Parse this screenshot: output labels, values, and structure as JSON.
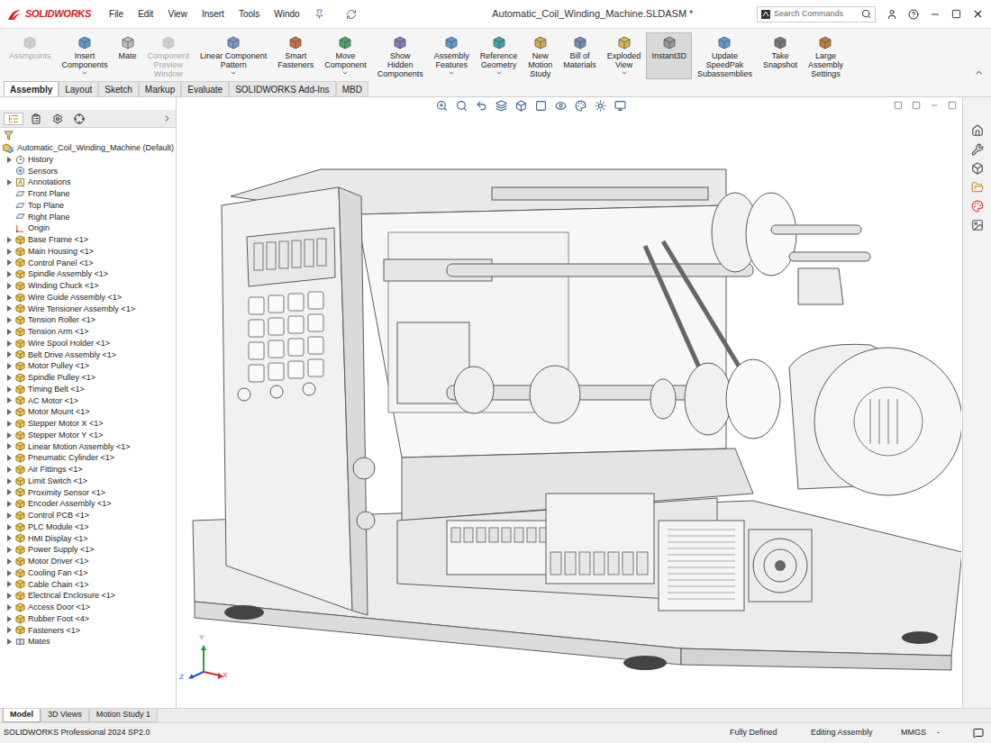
{
  "window": {
    "title": "Automatic_Coil_Winding_Machine.SLDASM *"
  },
  "app": {
    "logo": "SOLIDWORKS"
  },
  "menu": [
    "File",
    "Edit",
    "View",
    "Insert",
    "Tools",
    "Windo"
  ],
  "search": {
    "placeholder": "Search Commands"
  },
  "ribbon": [
    {
      "lines": [
        "Assmpoints"
      ],
      "disabled": true,
      "dropdown": false,
      "selected": false
    },
    {
      "lines": [
        "Insert",
        "Components"
      ],
      "disabled": false,
      "dropdown": true,
      "selected": false
    },
    {
      "lines": [
        "Mate"
      ],
      "disabled": false,
      "dropdown": false,
      "selected": false
    },
    {
      "lines": [
        "Component",
        "Preview",
        "Window"
      ],
      "disabled": true,
      "dropdown": false,
      "selected": false
    },
    {
      "lines": [
        "Linear Component",
        "Pattern"
      ],
      "disabled": false,
      "dropdown": true,
      "selected": false
    },
    {
      "lines": [
        "Smart",
        "Fasteners"
      ],
      "disabled": false,
      "dropdown": false,
      "selected": false
    },
    {
      "lines": [
        "Move",
        "Component"
      ],
      "disabled": false,
      "dropdown": true,
      "selected": false
    },
    {
      "lines": [
        "Show",
        "Hidden",
        "Components"
      ],
      "disabled": false,
      "dropdown": false,
      "selected": false
    },
    {
      "lines": [
        "Assembly",
        "Features"
      ],
      "disabled": false,
      "dropdown": true,
      "selected": false
    },
    {
      "lines": [
        "Reference",
        "Geometry"
      ],
      "disabled": false,
      "dropdown": true,
      "selected": false
    },
    {
      "lines": [
        "New",
        "Motion",
        "Study"
      ],
      "disabled": false,
      "dropdown": false,
      "selected": false
    },
    {
      "lines": [
        "Bill of",
        "Materials"
      ],
      "disabled": false,
      "dropdown": false,
      "selected": false
    },
    {
      "lines": [
        "Exploded",
        "View"
      ],
      "disabled": false,
      "dropdown": true,
      "selected": false
    },
    {
      "lines": [
        "Instant3D"
      ],
      "disabled": false,
      "dropdown": false,
      "selected": true
    },
    {
      "lines": [
        "Update",
        "SpeedPak",
        "Subassemblies"
      ],
      "disabled": false,
      "dropdown": false,
      "selected": false
    },
    {
      "lines": [
        "Take",
        "Snapshot"
      ],
      "disabled": false,
      "dropdown": false,
      "selected": false
    },
    {
      "lines": [
        "Large",
        "Assembly",
        "Settings"
      ],
      "disabled": false,
      "dropdown": false,
      "selected": false
    }
  ],
  "ribbon_tabs": [
    {
      "label": "Assembly",
      "selected": true
    },
    {
      "label": "Layout",
      "selected": false
    },
    {
      "label": "Sketch",
      "selected": false
    },
    {
      "label": "Markup",
      "selected": false
    },
    {
      "label": "Evaluate",
      "selected": false
    },
    {
      "label": "SOLIDWORKS Add-Ins",
      "selected": false
    },
    {
      "label": "MBD",
      "selected": false
    }
  ],
  "tree": {
    "root": "Automatic_Coil_Winding_Machine (Default)",
    "items": [
      {
        "label": "History",
        "kind": "history",
        "expandable": true
      },
      {
        "label": "Sensors",
        "kind": "sensor",
        "expandable": false
      },
      {
        "label": "Annotations",
        "kind": "annotation",
        "expandable": true
      },
      {
        "label": "Front Plane",
        "kind": "plane",
        "expandable": false
      },
      {
        "label": "Top Plane",
        "kind": "plane",
        "expandable": false
      },
      {
        "label": "Right Plane",
        "kind": "plane",
        "expandable": false
      },
      {
        "label": "Origin",
        "kind": "origin",
        "expandable": false
      },
      {
        "label": "Base Frame <1>",
        "kind": "part",
        "expandable": true
      },
      {
        "label": "Main Housing <1>",
        "kind": "part",
        "expandable": true
      },
      {
        "label": "Control Panel <1>",
        "kind": "part",
        "expandable": true
      },
      {
        "label": "Spindle Assembly <1>",
        "kind": "part",
        "expandable": true
      },
      {
        "label": "Winding Chuck <1>",
        "kind": "part",
        "expandable": true
      },
      {
        "label": "Wire Guide Assembly <1>",
        "kind": "part",
        "expandable": true
      },
      {
        "label": "Wire Tensioner Assembly <1>",
        "kind": "part",
        "expandable": true
      },
      {
        "label": "Tension Roller <1>",
        "kind": "part",
        "expandable": true
      },
      {
        "label": "Tension Arm <1>",
        "kind": "part",
        "expandable": true
      },
      {
        "label": "Wire Spool Holder <1>",
        "kind": "part",
        "expandable": true
      },
      {
        "label": "Belt Drive Assembly <1>",
        "kind": "part",
        "expandable": true
      },
      {
        "label": "Motor Pulley <1>",
        "kind": "part",
        "expandable": true
      },
      {
        "label": "Spindle Pulley <1>",
        "kind": "part",
        "expandable": true
      },
      {
        "label": "Timing Belt <1>",
        "kind": "part",
        "expandable": true
      },
      {
        "label": "AC Motor <1>",
        "kind": "part",
        "expandable": true
      },
      {
        "label": "Motor Mount <1>",
        "kind": "part",
        "expandable": true
      },
      {
        "label": "Stepper Motor X <1>",
        "kind": "part",
        "expandable": true
      },
      {
        "label": "Stepper Motor Y <1>",
        "kind": "part",
        "expandable": true
      },
      {
        "label": "Linear Motion Assembly <1>",
        "kind": "part",
        "expandable": true
      },
      {
        "label": "Pneumatic Cylinder <1>",
        "kind": "part",
        "expandable": true
      },
      {
        "label": "Air Fittings <1>",
        "kind": "part",
        "expandable": true
      },
      {
        "label": "Limit Switch <1>",
        "kind": "part",
        "expandable": true
      },
      {
        "label": "Proximity Sensor <1>",
        "kind": "part",
        "expandable": true
      },
      {
        "label": "Encoder Assembly <1>",
        "kind": "part",
        "expandable": true
      },
      {
        "label": "Control PCB <1>",
        "kind": "part",
        "expandable": true
      },
      {
        "label": "PLC Module <1>",
        "kind": "part",
        "expandable": true
      },
      {
        "label": "HMI Display <1>",
        "kind": "part",
        "expandable": true
      },
      {
        "label": "Power Supply <1>",
        "kind": "part",
        "expandable": true
      },
      {
        "label": "Motor Driver <1>",
        "kind": "part",
        "expandable": true
      },
      {
        "label": "Cooling Fan <1>",
        "kind": "part",
        "expandable": true
      },
      {
        "label": "Cable Chain <1>",
        "kind": "part",
        "expandable": true
      },
      {
        "label": "Electrical Enclosure <1>",
        "kind": "part",
        "expandable": true
      },
      {
        "label": "Access Door <1>",
        "kind": "part",
        "expandable": true
      },
      {
        "label": "Rubber Foot <4>",
        "kind": "part",
        "expandable": true
      },
      {
        "label": "Fasteners <1>",
        "kind": "part",
        "expandable": true
      },
      {
        "label": "Mates",
        "kind": "mates",
        "expandable": true
      }
    ]
  },
  "triad": {
    "x": "X",
    "y": "Y",
    "z": "Z"
  },
  "bottom_tabs": [
    {
      "label": "Model",
      "selected": true
    },
    {
      "label": "3D Views",
      "selected": false
    },
    {
      "label": "Motion Study 1",
      "selected": false
    }
  ],
  "status_bar": {
    "product": "SOLIDWORKS Professional 2024 SP2.0",
    "state": "Fully Defined",
    "mode": "Editing Assembly",
    "units": "MMGS",
    "units_arrow": "-"
  }
}
